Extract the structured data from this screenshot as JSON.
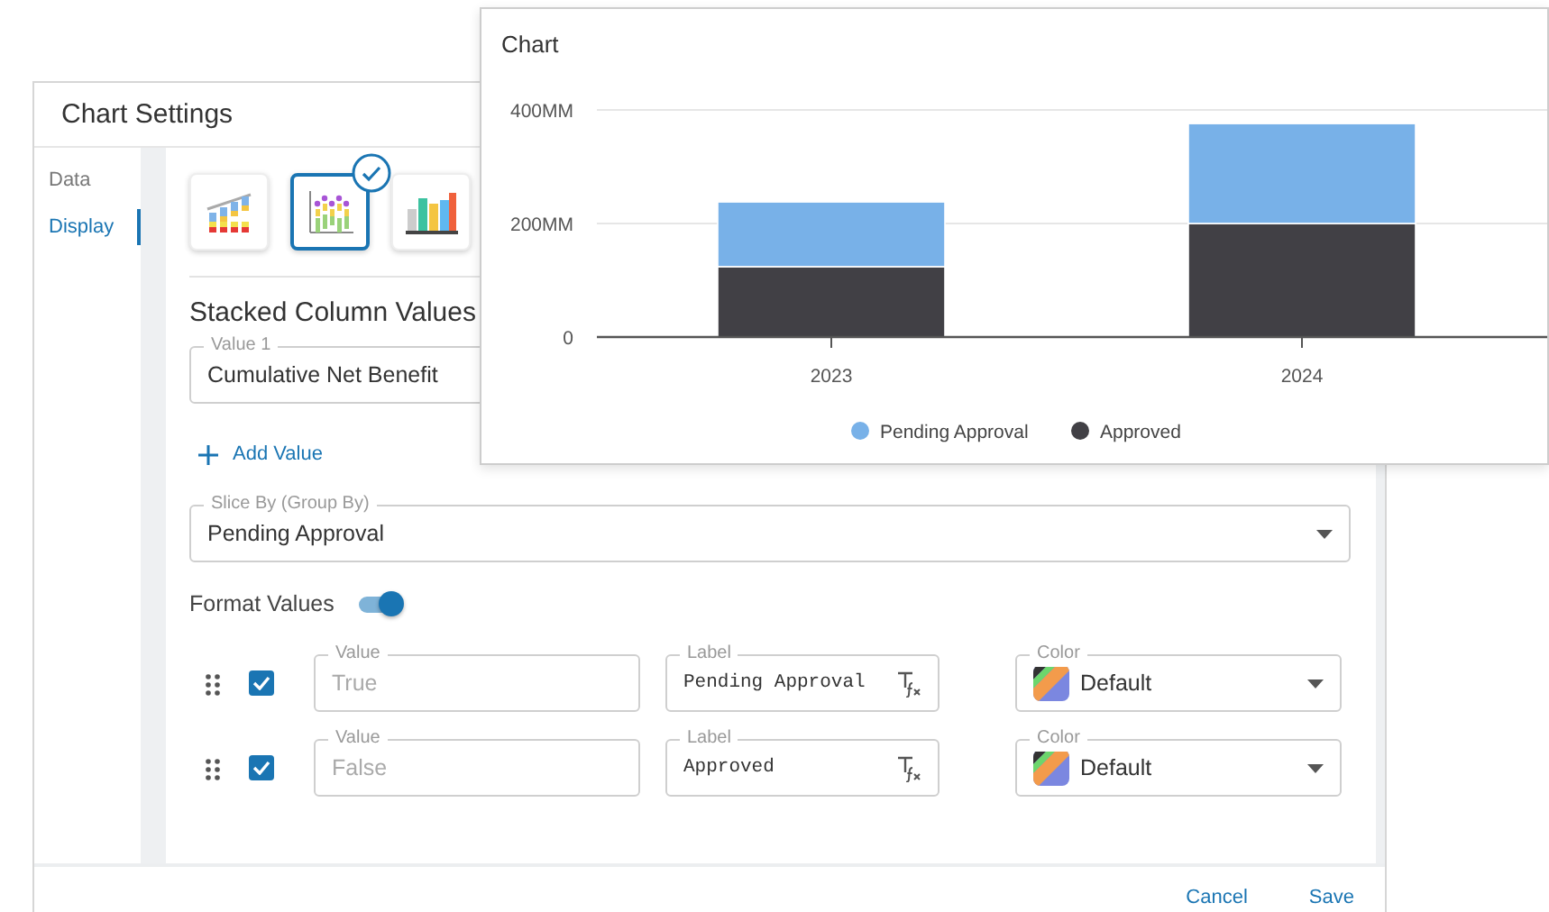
{
  "dialog": {
    "title": "Chart Settings",
    "nav": [
      {
        "label": "Data",
        "selected": false
      },
      {
        "label": "Display",
        "selected": true
      }
    ],
    "chart_types": [
      {
        "kind": "trend",
        "selected": false
      },
      {
        "kind": "scatter",
        "selected": true
      },
      {
        "kind": "bar",
        "selected": false
      }
    ],
    "section_title": "Stacked Column Values",
    "value_fields": [
      {
        "label": "Value 1",
        "value": "Cumulative Net Benefit"
      }
    ],
    "add_value": "Add Value",
    "slice_by": {
      "label": "Slice By (Group By)",
      "value": "Pending Approval"
    },
    "format_values": {
      "label": "Format Values",
      "on": true
    },
    "format_rows": [
      {
        "checked": true,
        "value": {
          "label": "Value",
          "placeholder": "True"
        },
        "label": {
          "label": "Label",
          "value": "Pending Approval"
        },
        "color": {
          "label": "Color",
          "value": "Default"
        }
      },
      {
        "checked": true,
        "value": {
          "label": "Value",
          "placeholder": "False"
        },
        "label": {
          "label": "Label",
          "value": "Approved"
        },
        "color": {
          "label": "Color",
          "value": "Default"
        }
      }
    ],
    "buttons": [
      "Cancel",
      "Save"
    ]
  },
  "chart_popup": {
    "title": "Chart",
    "chart_data": {
      "type": "bar",
      "stacked": true,
      "categories": [
        "2023",
        "2024"
      ],
      "series": [
        {
          "name": "Pending Approval",
          "color": "#78b1e8",
          "values": [
            114,
            176
          ]
        },
        {
          "name": "Approved",
          "color": "#414045",
          "values": [
            124,
            200
          ]
        }
      ],
      "ylim": [
        0,
        400
      ],
      "legend": true,
      "yticks": [
        {
          "value": 0,
          "label": "0"
        },
        {
          "value": 200,
          "label": "200MM"
        },
        {
          "value": 400,
          "label": "400MM"
        }
      ]
    }
  }
}
